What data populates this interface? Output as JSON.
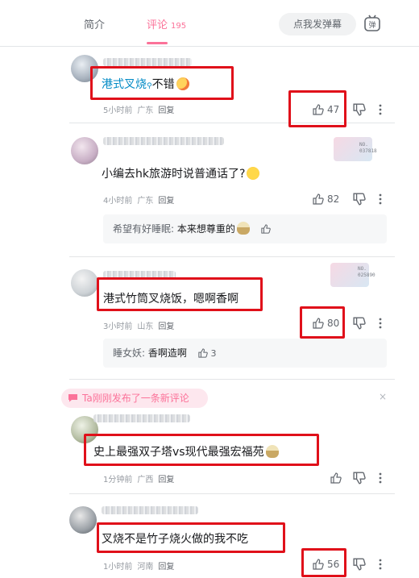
{
  "tabs": {
    "intro": "简介",
    "comments": "评论",
    "comment_count": "195"
  },
  "danmaku": {
    "placeholder": "点我发弹幕",
    "button_glyph": "弹"
  },
  "colors": {
    "accent": "#fb7299",
    "highlight_link": "#008ac5",
    "annotation_box": "#e0101a"
  },
  "comments": [
    {
      "content_link": "港式叉烧",
      "content_rest": "不错",
      "emoji": "heart-eyes",
      "time": "5小时前",
      "location": "广东",
      "reply_label": "回复",
      "likes": "47"
    },
    {
      "badge_no": "NO.\n037818",
      "content": "小编去hk旅游时说普通话了?",
      "emoji": "smile",
      "time": "4小时前",
      "location": "广东",
      "reply_label": "回复",
      "likes": "82",
      "sub_reply": {
        "user": "希望有好睡眠:",
        "text": "本来想尊重的"
      }
    },
    {
      "badge_no": "NO.\n025890",
      "content": "港式竹筒叉烧饭，嗯啊香啊",
      "time": "3小时前",
      "location": "山东",
      "reply_label": "回复",
      "likes": "80",
      "sub_reply": {
        "user": "睡女妖:",
        "text": "香啊造啊",
        "likes": "3"
      }
    },
    {
      "content": "史上最强双子塔vs现代最强宏福苑",
      "emoji": "bowl",
      "time": "1分钟前",
      "location": "广西",
      "reply_label": "回复"
    },
    {
      "content": "叉烧不是竹子烧火做的我不吃",
      "time": "1小时前",
      "location": "河南",
      "reply_label": "回复",
      "likes": "56"
    }
  ],
  "notice": {
    "text": "Ta刚刚发布了一条新评论",
    "close": "×"
  }
}
